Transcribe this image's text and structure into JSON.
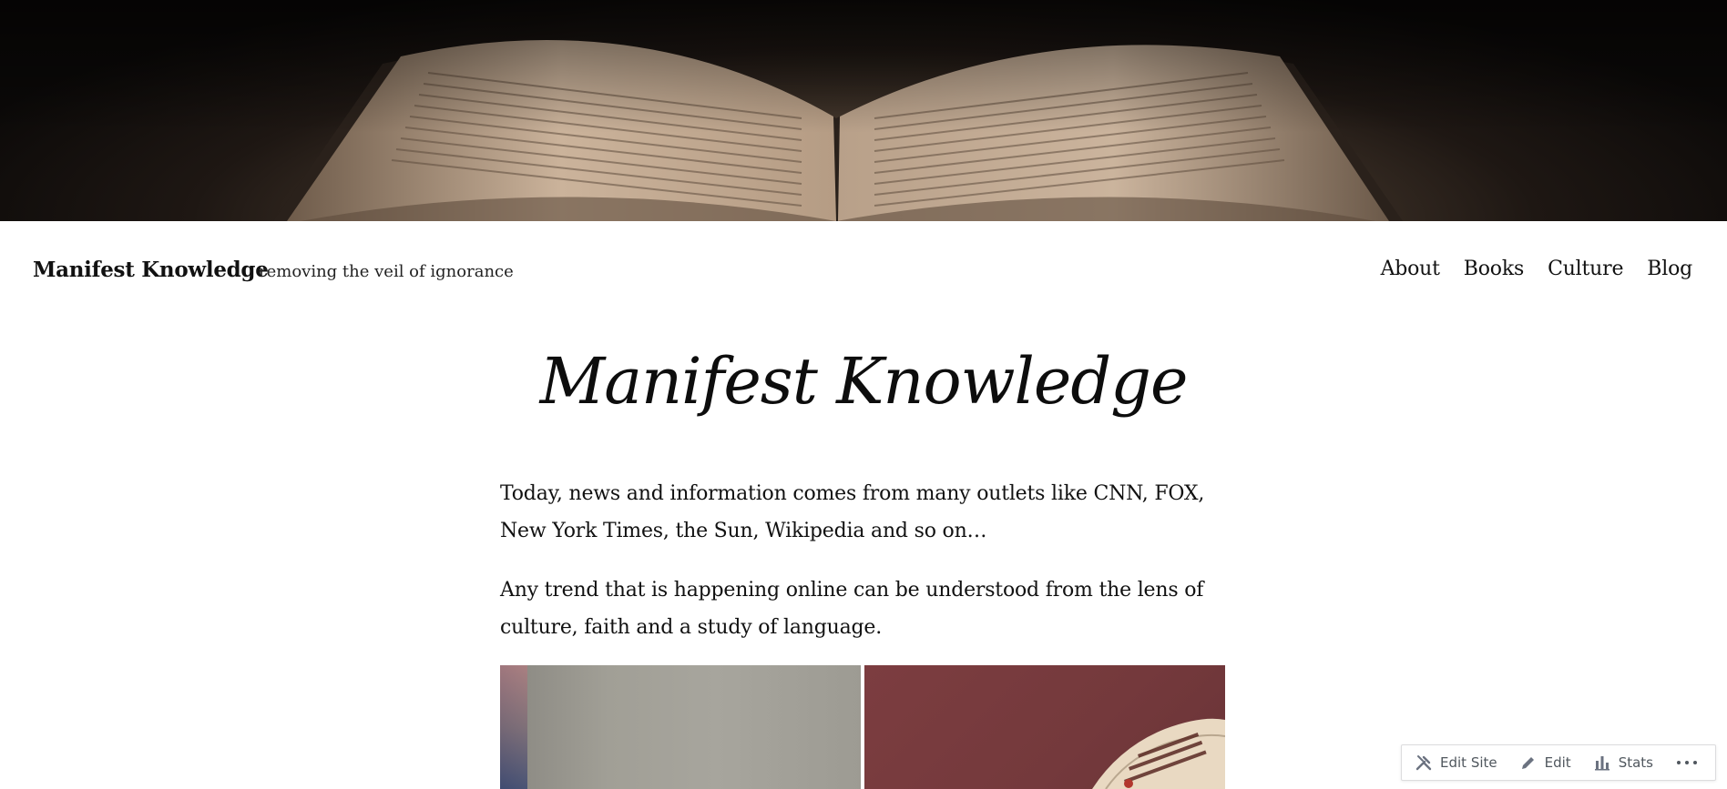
{
  "site": {
    "title": "Manifest Knowledge",
    "tagline": "removing the veil of ignorance"
  },
  "nav": {
    "items": [
      {
        "label": "About"
      },
      {
        "label": "Books"
      },
      {
        "label": "Culture"
      },
      {
        "label": "Blog"
      }
    ]
  },
  "main": {
    "title": "Manifest Knowledge",
    "paragraphs": [
      "Today, news and information comes from many outlets like CNN, FOX, New York Times, the Sun, Wikipedia and so on…",
      "Any trend that is happening online can be understood from the lens of culture, faith and a study of language."
    ],
    "gallery": [
      {
        "icon": "blurred-books-photo"
      },
      {
        "icon": "illuminated-manuscript-photo"
      }
    ]
  },
  "admin_bar": {
    "edit_site_label": "Edit Site",
    "edit_label": "Edit",
    "stats_label": "Stats",
    "icons": [
      "tools-icon",
      "pencil-icon",
      "bar-chart-icon",
      "more-icon"
    ]
  },
  "colors": {
    "text": "#111111",
    "admin_text": "#50575e",
    "admin_border": "#dcdcde"
  }
}
